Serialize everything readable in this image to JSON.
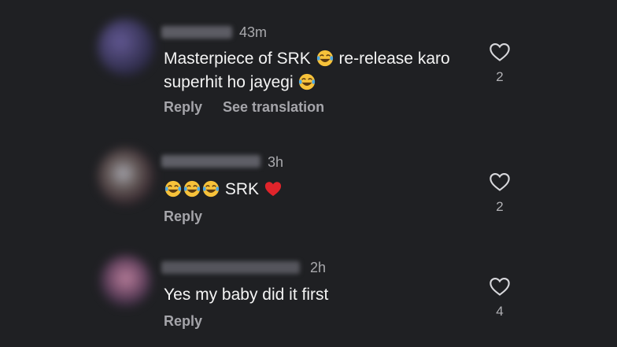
{
  "comments": [
    {
      "time": "43m",
      "text_a": "Masterpiece of SRK",
      "text_b": "re-release karo",
      "text_c": "superhit ho jayegi",
      "reply": "Reply",
      "see_translation": "See translation",
      "likes": "2",
      "icons": [
        "tears-of-joy-emoji-icon",
        "heart-outline-icon"
      ]
    },
    {
      "time": "3h",
      "text_a": "SRK",
      "reply": "Reply",
      "likes": "2",
      "icons": [
        "tears-of-joy-emoji-icon",
        "red-heart-emoji-icon",
        "heart-outline-icon"
      ]
    },
    {
      "time": "2h",
      "text_a": "Yes my baby did it first",
      "reply": "Reply",
      "likes": "4",
      "icons": [
        "heart-outline-icon"
      ]
    }
  ],
  "colors": {
    "background": "#1f2023",
    "text": "#f4f4f4",
    "secondary": "#a5a5aa",
    "heart": "#e0242b",
    "emoji_face": "#f7c23a"
  }
}
